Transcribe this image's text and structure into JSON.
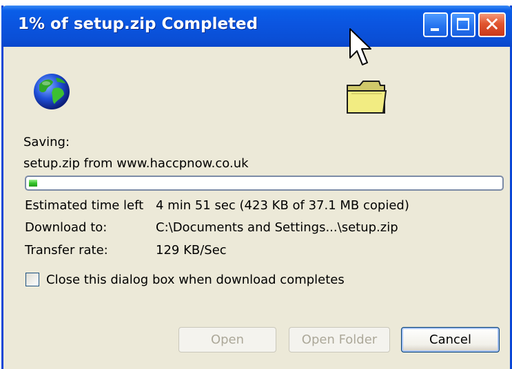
{
  "window": {
    "title": "1% of setup.zip Completed"
  },
  "titlebar_buttons": {
    "minimize": "minimize-icon",
    "maximize": "maximize-icon",
    "close": "close-icon"
  },
  "status": {
    "saving_label": "Saving:",
    "file_line": "setup.zip from www.haccpnow.co.uk",
    "progress": 0.01
  },
  "details": [
    {
      "label": "Estimated time left",
      "value": "4 min 51 sec (423 KB of 37.1 MB copied)"
    },
    {
      "label": "Download to:",
      "value": "C:\\Documents and Settings...\\setup.zip"
    },
    {
      "label": "Transfer rate:",
      "value": "129 KB/Sec"
    }
  ],
  "checkbox": {
    "label": "Close this dialog box when download completes",
    "checked": false
  },
  "buttons": {
    "open": "Open",
    "open_folder": "Open Folder",
    "cancel": "Cancel"
  },
  "icons": {
    "globe": "globe-icon",
    "folder": "folder-icon",
    "cursor": "mouse-cursor-icon"
  },
  "colors": {
    "titlebar": "#0a55e0",
    "progress": "#35c52a",
    "close": "#e1552f",
    "window_bg": "#ece9d8"
  }
}
